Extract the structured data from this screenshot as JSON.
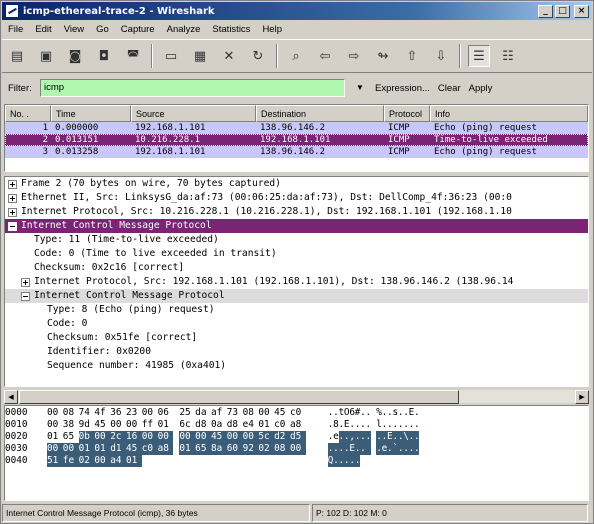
{
  "window": {
    "title": "icmp-ethereal-trace-2 - Wireshark"
  },
  "menu": [
    "File",
    "Edit",
    "View",
    "Go",
    "Capture",
    "Analyze",
    "Statistics",
    "Help"
  ],
  "filter": {
    "label": "Filter:",
    "value": "icmp",
    "expression": "Expression...",
    "clear": "Clear",
    "apply": "Apply"
  },
  "packet_list": {
    "columns": [
      "No. .",
      "Time",
      "Source",
      "Destination",
      "Protocol",
      "Info"
    ],
    "rows": [
      {
        "no": "1",
        "time": "0.000000",
        "src": "192.168.1.101",
        "dst": "138.96.146.2",
        "proto": "ICMP",
        "info": "Echo (ping) request",
        "bg": "#c8c8f8",
        "fg": "#000000"
      },
      {
        "no": "2",
        "time": "0.013151",
        "src": "10.216.228.1",
        "dst": "192.168.1.101",
        "proto": "ICMP",
        "info": "Time-to-live exceeded",
        "bg": "#7b2374",
        "fg": "#ffffff"
      },
      {
        "no": "3",
        "time": "0.013258",
        "src": "192.168.1.101",
        "dst": "138.96.146.2",
        "proto": "ICMP",
        "info": "Echo (ping) request",
        "bg": "#c8c8f8",
        "fg": "#000000"
      }
    ]
  },
  "tree": [
    {
      "indent": 0,
      "exp": "plus",
      "text": "Frame 2 (70 bytes on wire, 70 bytes captured)",
      "style": ""
    },
    {
      "indent": 0,
      "exp": "plus",
      "text": "Ethernet II, Src: LinksysG_da:af:73 (00:06:25:da:af:73), Dst: DellComp_4f:36:23 (00:0",
      "style": ""
    },
    {
      "indent": 0,
      "exp": "plus",
      "text": "Internet Protocol, Src: 10.216.228.1 (10.216.228.1), Dst: 192.168.1.101 (192.168.1.10",
      "style": ""
    },
    {
      "indent": 0,
      "exp": "minus",
      "text": "Internet Control Message Protocol",
      "style": "sel"
    },
    {
      "indent": 1,
      "exp": "",
      "text": "Type: 11 (Time-to-live exceeded)",
      "style": ""
    },
    {
      "indent": 1,
      "exp": "",
      "text": "Code: 0 (Time to live exceeded in transit)",
      "style": ""
    },
    {
      "indent": 1,
      "exp": "",
      "text": "Checksum: 0x2c16 [correct]",
      "style": ""
    },
    {
      "indent": 1,
      "exp": "plus",
      "text": "Internet Protocol, Src: 192.168.1.101 (192.168.1.101), Dst: 138.96.146.2 (138.96.14",
      "style": ""
    },
    {
      "indent": 1,
      "exp": "minus",
      "text": "Internet Control Message Protocol",
      "style": "hl"
    },
    {
      "indent": 2,
      "exp": "",
      "text": "Type: 8 (Echo (ping) request)",
      "style": ""
    },
    {
      "indent": 2,
      "exp": "",
      "text": "Code: 0",
      "style": ""
    },
    {
      "indent": 2,
      "exp": "",
      "text": "Checksum: 0x51fe [correct]",
      "style": ""
    },
    {
      "indent": 2,
      "exp": "",
      "text": "Identifier: 0x0200",
      "style": ""
    },
    {
      "indent": 2,
      "exp": "",
      "text": "Sequence number: 41985 (0xa401)",
      "style": ""
    }
  ],
  "hex": [
    {
      "off": "0000",
      "bytes": [
        "00",
        "08",
        "74",
        "4f",
        "36",
        "23",
        "00",
        "06",
        "25",
        "da",
        "af",
        "73",
        "08",
        "00",
        "45",
        "c0"
      ],
      "ascii": "..tO6#.. %..s..E."
    },
    {
      "off": "0010",
      "bytes": [
        "00",
        "38",
        "9d",
        "45",
        "00",
        "00",
        "ff",
        "01",
        "6c",
        "d8",
        "0a",
        "d8",
        "e4",
        "01",
        "c0",
        "a8"
      ],
      "ascii": ".8.E.... l......."
    },
    {
      "off": "0020",
      "bytes": [
        "01",
        "65",
        "0b",
        "00",
        "2c",
        "16",
        "00",
        "00",
        "00",
        "00",
        "45",
        "00",
        "00",
        "5c",
        "d2",
        "d5"
      ],
      "ascii": ".e..,... ..E..\\.."
    },
    {
      "off": "0030",
      "bytes": [
        "00",
        "00",
        "01",
        "01",
        "d1",
        "45",
        "c0",
        "a8",
        "01",
        "65",
        "8a",
        "60",
        "92",
        "02",
        "08",
        "00"
      ],
      "ascii": "....E.. .e.`...."
    },
    {
      "off": "0040",
      "bytes": [
        "51",
        "fe",
        "02",
        "00",
        "a4",
        "01"
      ],
      "ascii": "Q....."
    }
  ],
  "hex_selection": {
    "start": 34,
    "end": 70
  },
  "status": {
    "left": "Internet Control Message Protocol (icmp), 36 bytes",
    "middle": "P: 102 D: 102 M: 0"
  },
  "icons": [
    "new-capture-icon",
    "capture-options-icon",
    "start-capture-icon",
    "stop-capture-icon",
    "restart-capture-icon",
    "open-icon",
    "save-icon",
    "close-file-icon",
    "reload-icon",
    "print-icon",
    "find-icon",
    "go-back-icon",
    "go-forward-icon",
    "go-to-packet-icon",
    "go-first-icon",
    "go-last-icon",
    "colorize-icon",
    "autoscroll-icon"
  ],
  "colors": {
    "selected": "#7b2374",
    "echo_row": "#c8c8f8",
    "filter_valid": "#b0f8b0",
    "hex_selection": "#3b5d78"
  }
}
